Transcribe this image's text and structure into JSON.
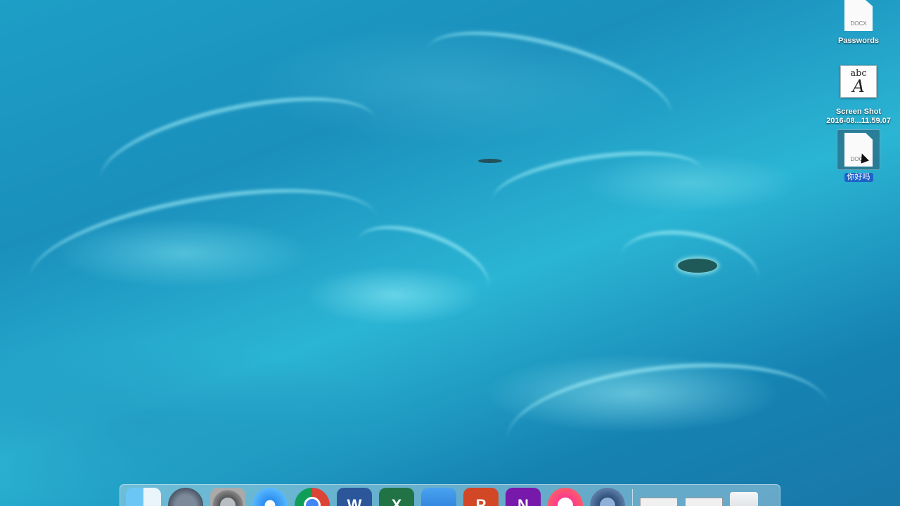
{
  "desktop": {
    "icons": [
      {
        "label": "Passwords",
        "ext": "DOCX",
        "kind": "docx"
      },
      {
        "label_line1": "Screen Shot",
        "label_line2": "2016-08...11.59.07",
        "thumb_small": "abc",
        "thumb_large": "A",
        "kind": "font-file"
      },
      {
        "label": "你好吗",
        "ext": "DOCX",
        "kind": "docx",
        "selected": true
      }
    ]
  },
  "dock": {
    "letters": {
      "word": "W",
      "excel": "X",
      "ppt": "P",
      "onenote": "N"
    }
  }
}
